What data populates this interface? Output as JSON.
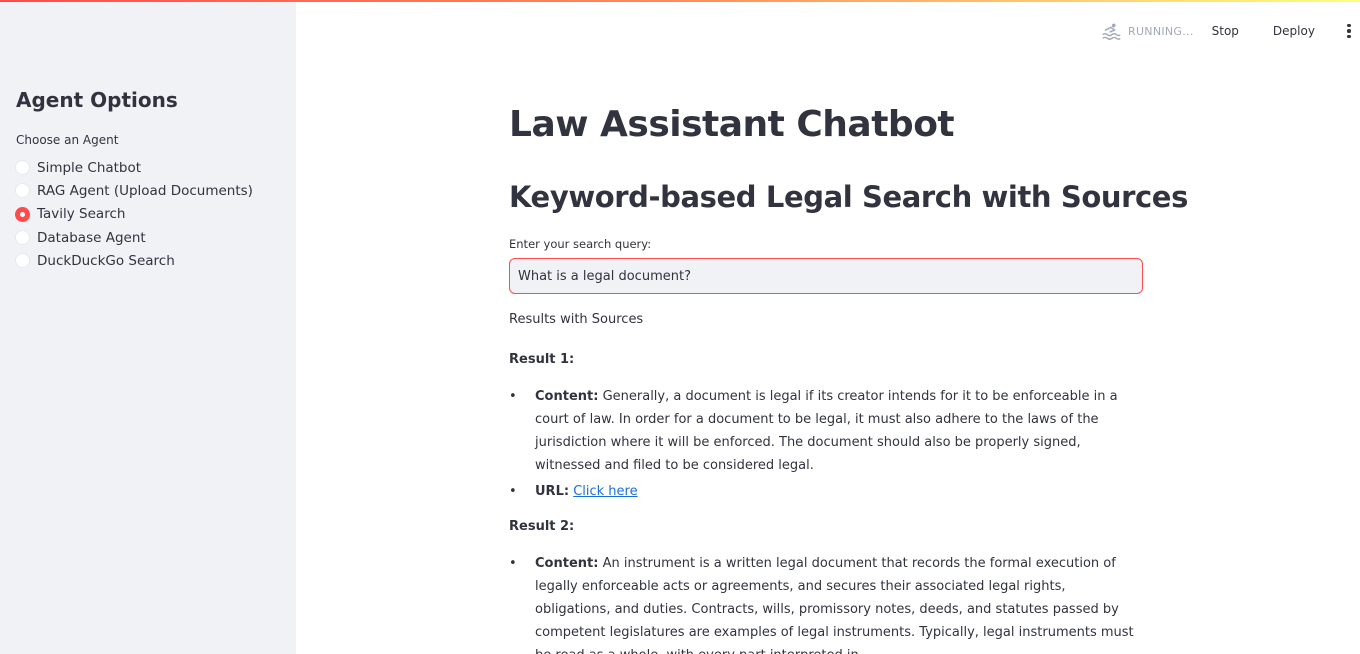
{
  "sidebar": {
    "title": "Agent Options",
    "choose_label": "Choose an Agent",
    "options": [
      {
        "label": "Simple Chatbot",
        "selected": false
      },
      {
        "label": "RAG Agent (Upload Documents)",
        "selected": false
      },
      {
        "label": "Tavily Search",
        "selected": true
      },
      {
        "label": "Database Agent",
        "selected": false
      },
      {
        "label": "DuckDuckGo Search",
        "selected": false
      }
    ]
  },
  "header": {
    "status_text": "RUNNING...",
    "stop_label": "Stop",
    "deploy_label": "Deploy",
    "menu_icon": "vertical-dots-icon",
    "status_icon": "running-swimmer-icon"
  },
  "main": {
    "title": "Law Assistant Chatbot",
    "subtitle": "Keyword-based Legal Search with Sources",
    "search": {
      "label": "Enter your search query:",
      "value": "What is a legal document?"
    },
    "results_heading": "Results with Sources",
    "results": [
      {
        "title": "Result 1:",
        "content_label": "Content:",
        "content": "Generally, a document is legal if its creator intends for it to be enforceable in a court of law. In order for a document to be legal, it must also adhere to the laws of the jurisdiction where it will be enforced. The document should also be properly signed, witnessed and filed to be considered legal.",
        "url_label": "URL:",
        "url_link_text": "Click here"
      },
      {
        "title": "Result 2:",
        "content_label": "Content:",
        "content": "An instrument is a written legal document that records the formal execution of legally enforceable acts or agreements, and secures their associated legal rights, obligations, and duties. Contracts, wills, promissory notes, deeds, and statutes passed by competent legislatures are examples of legal instruments. Typically, legal instruments must be read as a whole, with every part interpreted in"
      }
    ]
  },
  "colors": {
    "accent": "#ff4b4b",
    "sidebar_bg": "#f0f2f6",
    "text": "#31333f",
    "link": "#1a6fd6"
  }
}
